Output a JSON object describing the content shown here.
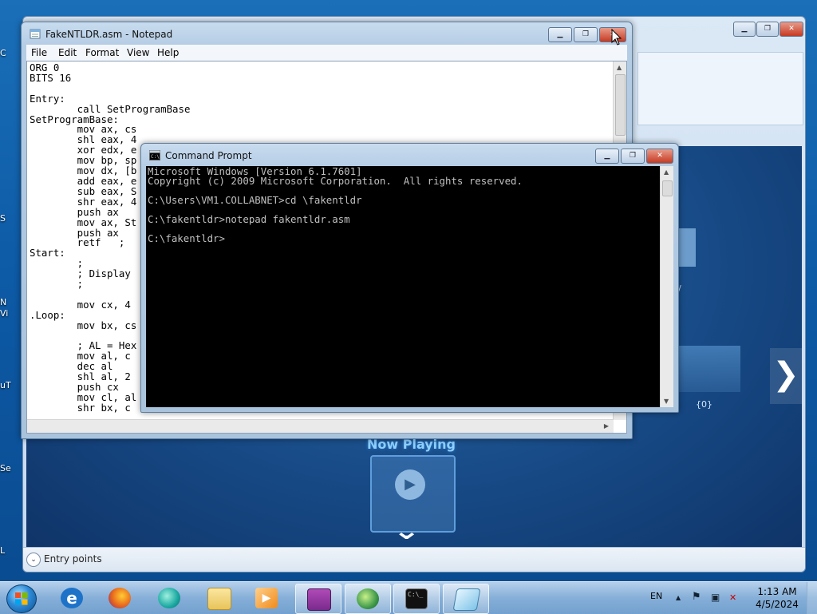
{
  "desktop": {
    "edge_labels": [
      "C",
      "S",
      "N",
      "Vi",
      "uT",
      "Se",
      "L"
    ]
  },
  "media_window": {
    "now_playing_label": "Now Playing",
    "tile_label": "{0}",
    "side_label": "/",
    "entry_points_label": "Entry points",
    "next_arrow": "❯",
    "play_symbol": "▶",
    "down_chevron": "⌄",
    "expand_symbol": "⌄"
  },
  "notepad": {
    "title": "FakeNTLDR.asm - Notepad",
    "menu": [
      "File",
      "Edit",
      "Format",
      "View",
      "Help"
    ],
    "content": "ORG 0\nBITS 16\n\nEntry:\n        call SetProgramBase\nSetProgramBase:\n        mov ax, cs\n        shl eax, 4\n        xor edx, e\n        mov bp, sp\n        mov dx, [b\n        add eax, e\n        sub eax, S\n        shr eax, 4\n        push ax\n        mov ax, St\n        push ax\n        retf   ;\nStart:\n        ;\n        ; Display\n        ;\n\n        mov cx, 4\n.Loop:\n        mov bx, cs\n\n        ; AL = Hex\n        mov al, c\n        dec al\n        shl al, 2\n        push cx\n        mov cl, al\n        shr bx, c"
  },
  "cmd": {
    "title": "Command Prompt",
    "content": "Microsoft Windows [Version 6.1.7601]\nCopyright (c) 2009 Microsoft Corporation.  All rights reserved.\n\nC:\\Users\\VM1.COLLABNET>cd \\fakentldr\n\nC:\\fakentldr>notepad fakentldr.asm\n\nC:\\fakentldr>"
  },
  "window_controls": {
    "minimize": "▁",
    "maximize": "❐",
    "close": "✕"
  },
  "taskbar": {
    "language": "EN",
    "tray_up": "▲",
    "tray_flag": "⚑",
    "tray_net": "▣",
    "tray_sound": "✕",
    "time": "1:13 AM",
    "date": "4/5/2024",
    "cmd_icon_text": "C:\\_",
    "colors": {
      "ie": "#1e73c8",
      "firefox": "#e8661c",
      "chat": "#1aa8a0",
      "explorer": "#e8c45a",
      "media": "#f08a1c",
      "winrar": "#7a2a8c",
      "media_center": "#3f9a4a",
      "cmd": "#111111",
      "notepad": "#7fc4e8"
    }
  }
}
